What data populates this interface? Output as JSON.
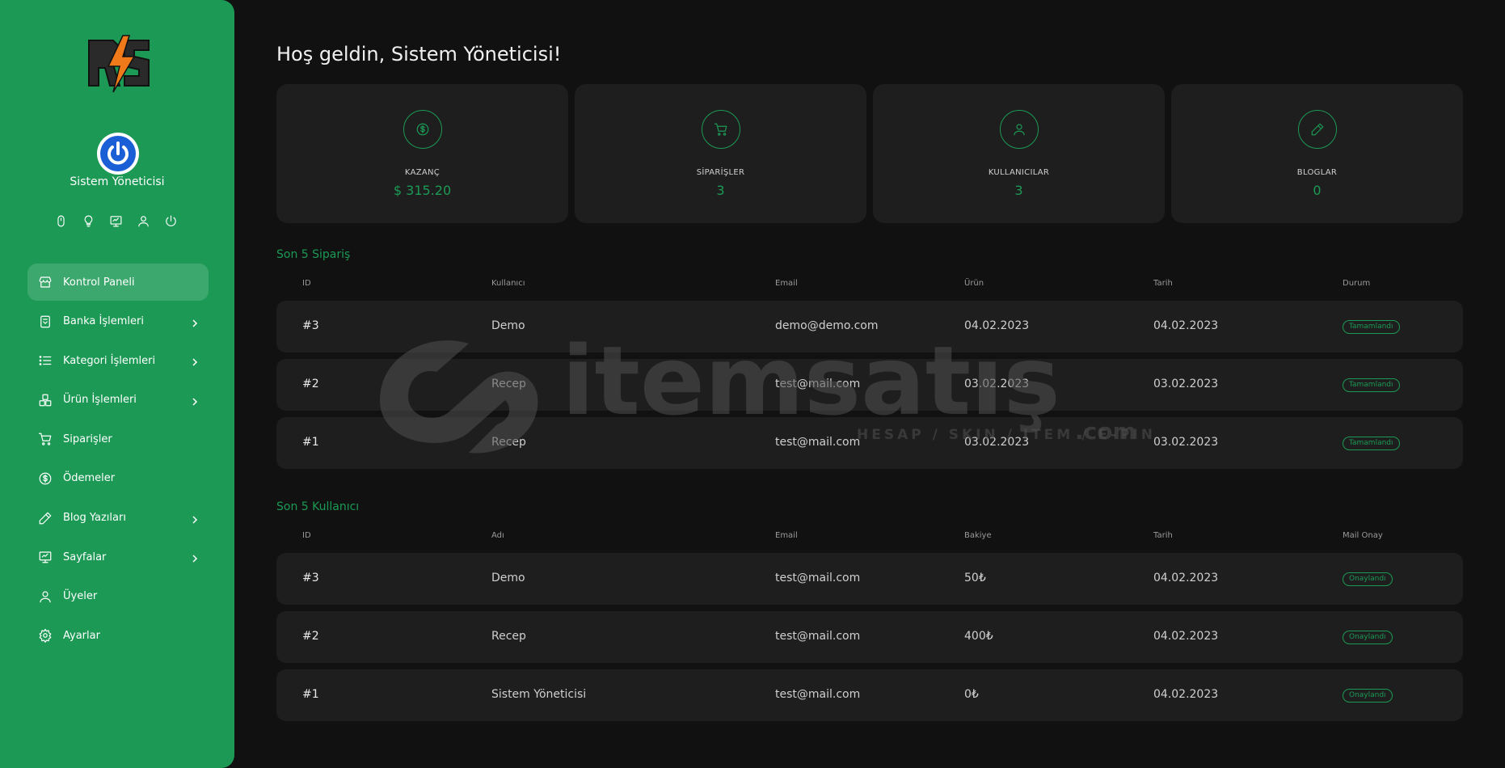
{
  "sidebar": {
    "user_name": "Sistem Yöneticisi",
    "quick_icons": [
      "mouse-icon",
      "lightbulb-icon",
      "monitor-icon",
      "user-icon",
      "power-icon"
    ],
    "menu": [
      {
        "label": "Kontrol Paneli",
        "icon": "store-icon",
        "active": true,
        "has_children": false
      },
      {
        "label": "Banka İşlemleri",
        "icon": "bank-icon",
        "active": false,
        "has_children": true
      },
      {
        "label": "Kategori İşlemleri",
        "icon": "list-icon",
        "active": false,
        "has_children": true
      },
      {
        "label": "Ürün İşlemleri",
        "icon": "boxes-icon",
        "active": false,
        "has_children": true
      },
      {
        "label": "Siparişler",
        "icon": "cart-icon",
        "active": false,
        "has_children": false
      },
      {
        "label": "Ödemeler",
        "icon": "dollar-icon",
        "active": false,
        "has_children": false
      },
      {
        "label": "Blog Yazıları",
        "icon": "pencil-icon",
        "active": false,
        "has_children": true
      },
      {
        "label": "Sayfalar",
        "icon": "monitor-icon",
        "active": false,
        "has_children": true
      },
      {
        "label": "Üyeler",
        "icon": "user-icon",
        "active": false,
        "has_children": false
      },
      {
        "label": "Ayarlar",
        "icon": "gear-icon",
        "active": false,
        "has_children": false
      }
    ]
  },
  "main": {
    "welcome": "Hoş geldin, Sistem Yöneticisi!",
    "stats": [
      {
        "label": "KAZANÇ",
        "value": "$ 315.20",
        "icon": "dollar-icon"
      },
      {
        "label": "SİPARİŞLER",
        "value": "3",
        "icon": "cart-icon"
      },
      {
        "label": "KULLANICILAR",
        "value": "3",
        "icon": "user-icon"
      },
      {
        "label": "BLOGLAR",
        "value": "0",
        "icon": "pencil-icon"
      }
    ],
    "orders": {
      "title": "Son 5 Sipariş",
      "headers": [
        "ID",
        "Kullanıcı",
        "Email",
        "Ürün",
        "Tarih",
        "Durum"
      ],
      "rows": [
        {
          "id": "#3",
          "user": "Demo",
          "email": "demo@demo.com",
          "product": "04.02.2023",
          "date": "04.02.2023",
          "status": "Tamamlandı"
        },
        {
          "id": "#2",
          "user": "Recep",
          "email": "test@mail.com",
          "product": "03.02.2023",
          "date": "03.02.2023",
          "status": "Tamamlandı"
        },
        {
          "id": "#1",
          "user": "Recep",
          "email": "test@mail.com",
          "product": "03.02.2023",
          "date": "03.02.2023",
          "status": "Tamamlandı"
        }
      ]
    },
    "users": {
      "title": "Son 5 Kullanıcı",
      "headers": [
        "ID",
        "Adı",
        "Email",
        "Bakiye",
        "Tarih",
        "Mail Onay"
      ],
      "rows": [
        {
          "id": "#3",
          "name": "Demo",
          "email": "test@mail.com",
          "balance": "50₺",
          "date": "04.02.2023",
          "status": "Onaylandı"
        },
        {
          "id": "#2",
          "name": "Recep",
          "email": "test@mail.com",
          "balance": "400₺",
          "date": "04.02.2023",
          "status": "Onaylandı"
        },
        {
          "id": "#1",
          "name": "Sistem Yöneticisi",
          "email": "test@mail.com",
          "balance": "0₺",
          "date": "04.02.2023",
          "status": "Onaylandı"
        }
      ]
    }
  },
  "watermark": {
    "brand": "itemsatış",
    "tagline": "HESAP / SKIN / ITEM / E-PIN",
    "suffix": ".com"
  },
  "colors": {
    "accent": "#1c9a55",
    "background": "#111111",
    "card": "#1e1e1e"
  }
}
